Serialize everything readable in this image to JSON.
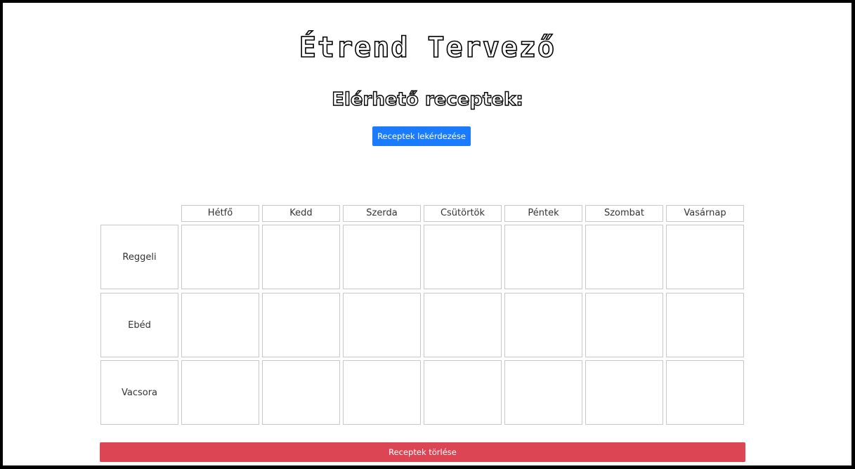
{
  "page": {
    "title": "Étrend Tervező",
    "subtitle": "Elérhető receptek:"
  },
  "buttons": {
    "fetch_label": "Receptek lekérdezése",
    "delete_label": "Receptek törlése",
    "fetch_color": "#1a7bff",
    "delete_color": "#dc4553"
  },
  "planner": {
    "days": [
      "Hétfő",
      "Kedd",
      "Szerda",
      "Csütörtök",
      "Péntek",
      "Szombat",
      "Vasárnap"
    ],
    "meals": [
      "Reggeli",
      "Ebéd",
      "Vacsora"
    ]
  }
}
